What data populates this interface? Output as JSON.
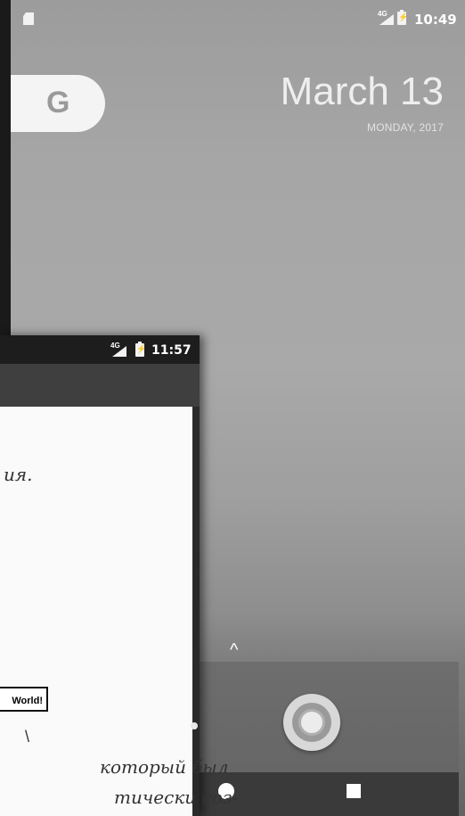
{
  "home": {
    "status_time": "10:49",
    "network": "4G",
    "google_letter": "G",
    "date": "March 13",
    "day_year": "MONDAY, 2017",
    "app_drawer_caret": "^"
  },
  "overlay_phone": {
    "status_time": "11:57",
    "network": "4G",
    "line1": "ия.",
    "hello_label": "World!",
    "arrow": "\\",
    "hand_line1": "который был",
    "hand_line2": "тически соз-"
  },
  "colors": {
    "wallpaper": "#a6a6a6",
    "dock": "#6a6a6a",
    "appbar": "#3f3f3f"
  }
}
